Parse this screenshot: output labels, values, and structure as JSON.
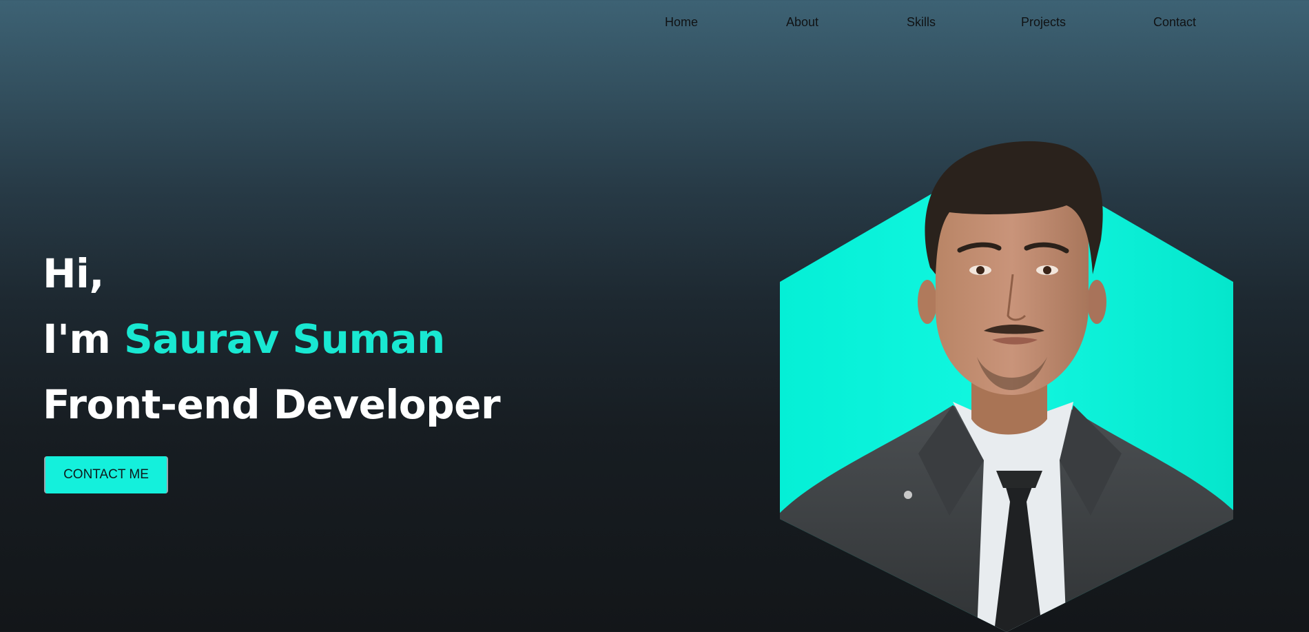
{
  "nav": {
    "items": [
      {
        "label": "Home"
      },
      {
        "label": "About"
      },
      {
        "label": "Skills"
      },
      {
        "label": "Projects"
      },
      {
        "label": "Contact"
      }
    ]
  },
  "hero": {
    "greeting": "Hi,",
    "intro_prefix": "I'm ",
    "name": "Saurav Suman",
    "role": "Front-end Developer",
    "cta_label": "CONTACT ME"
  },
  "colors": {
    "accent": "#19e8d2",
    "button": "#14f0dc",
    "hexagon": "#05efd6"
  },
  "portrait": {
    "icon": "person-portrait-icon"
  }
}
